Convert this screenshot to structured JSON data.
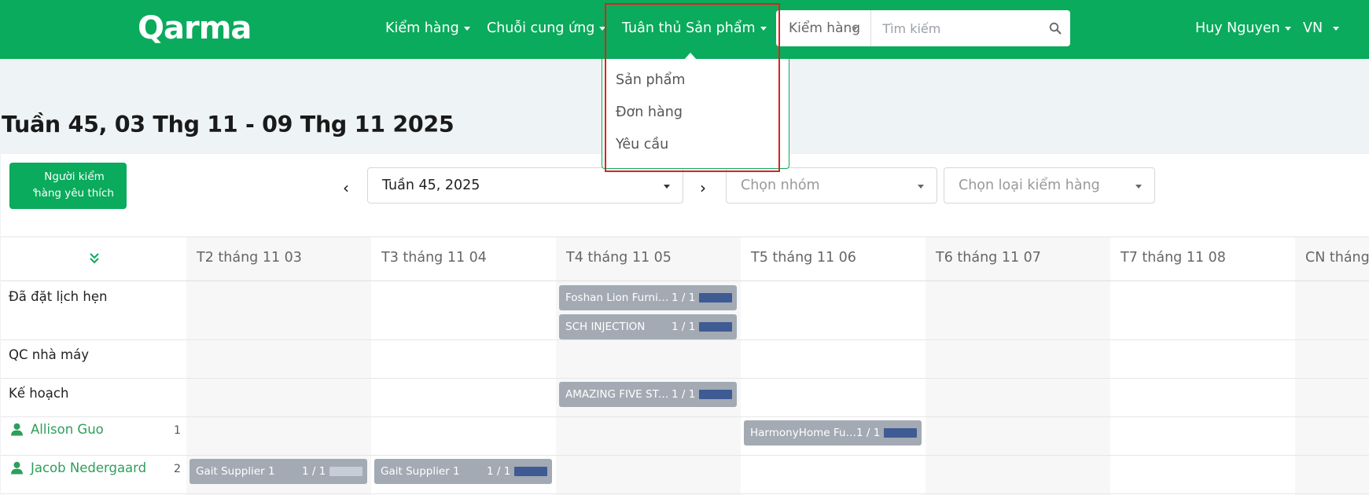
{
  "header": {
    "logo": "Qarma",
    "nav": [
      {
        "label": "Kiểm hàng"
      },
      {
        "label": "Chuỗi cung ứng"
      },
      {
        "label": "Tuân thủ Sản phẩm"
      }
    ],
    "search": {
      "type_label": "Kiểm hàng",
      "placeholder": "Tìm kiếm"
    },
    "user_name": "Huy Nguyen",
    "language": "VN"
  },
  "dropdown": {
    "items": [
      "Sản phẩm",
      "Đơn hàng",
      "Yêu cầu"
    ]
  },
  "page_title": "Tuần 45, 03 Thg 11 - 09 Thg 11 2025",
  "controls": {
    "favorite_button": [
      "Người kiểm",
      "hàng yêu thích"
    ],
    "week_select": "Tuần 45, 2025",
    "group_placeholder": "Chọn nhóm",
    "inspection_type_placeholder": "Chọn loại kiểm hàng"
  },
  "schedule": {
    "days": [
      "T2 tháng 11 03",
      "T3 tháng 11 04",
      "T4 tháng 11 05",
      "T5 tháng 11 06",
      "T6 tháng 11 07",
      "T7 tháng 11 08",
      "CN tháng"
    ],
    "rows": [
      {
        "label": "Đã đặt lịch hẹn"
      },
      {
        "label": "QC nhà máy"
      },
      {
        "label": "Kế hoạch"
      },
      {
        "label": "Allison Guo",
        "count": "1"
      },
      {
        "label": "Jacob Nedergaard",
        "count": "2"
      }
    ],
    "bookings": [
      {
        "name": "Foshan Lion Furniture",
        "ratio": "1 / 1",
        "progress": 1
      },
      {
        "name": "SCH INJECTION",
        "ratio": "1 / 1",
        "progress": 1
      },
      {
        "name": "AMAZING FIVE STAR",
        "ratio": "1 / 1",
        "progress": 1
      },
      {
        "name": "HarmonyHome Furniture",
        "ratio": "1 / 1",
        "progress": 1
      },
      {
        "name": "Gait Supplier 1",
        "ratio": "1 / 1",
        "progress": 0
      },
      {
        "name": "Gait Supplier 1",
        "ratio": "1 / 1",
        "progress": 1
      }
    ]
  },
  "colors": {
    "brand": "#0aab5c",
    "chip": "#a3aab3",
    "progress": "#3f5b94",
    "highlight": "#e02020"
  }
}
